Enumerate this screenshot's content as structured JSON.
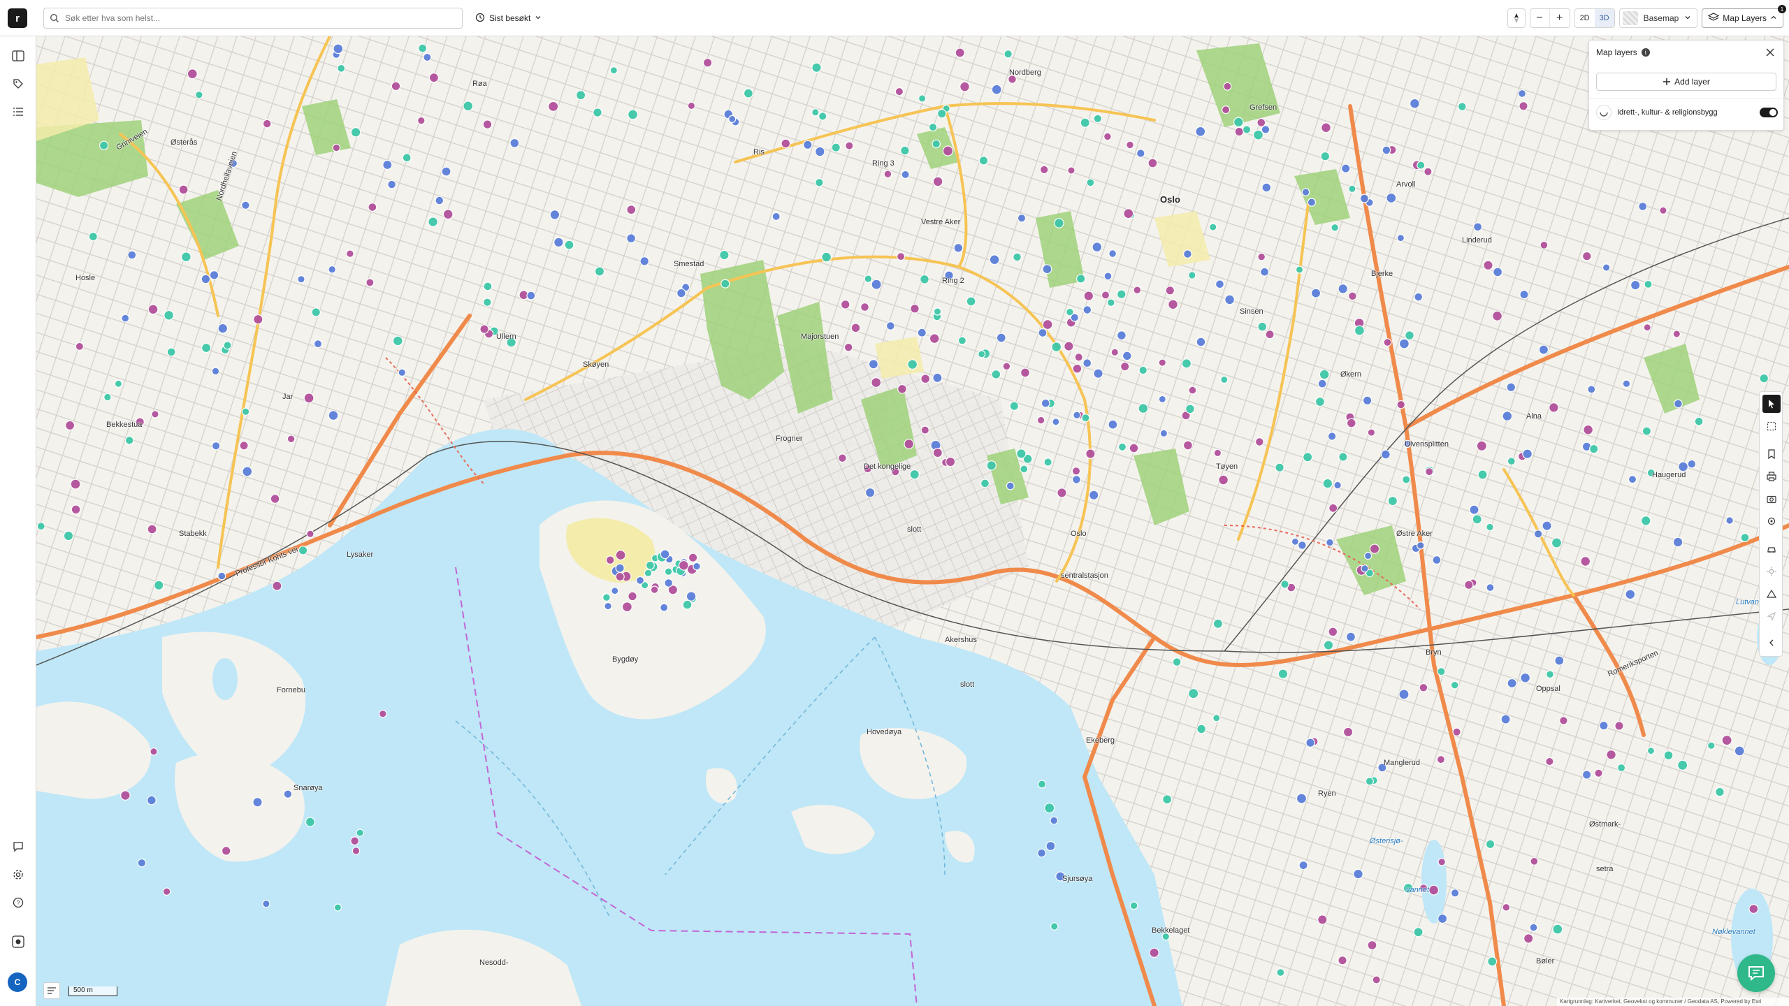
{
  "app": {
    "logo_letter": "r"
  },
  "search": {
    "placeholder": "Søk etter hva som helst..."
  },
  "recent": {
    "label": "Sist besøkt"
  },
  "view": {
    "mode_2d": "2D",
    "mode_3d": "3D",
    "active_mode": "3D"
  },
  "zoom": {
    "out": "−",
    "in": "+"
  },
  "basemap": {
    "label": "Basemap"
  },
  "map_layers_button": {
    "label": "Map Layers",
    "badge": "1"
  },
  "panel": {
    "title": "Map layers",
    "info": "i",
    "add_label": "Add layer",
    "layers": [
      {
        "name": "Idrett-, kultur- & religionsbygg",
        "visible": true
      }
    ]
  },
  "user": {
    "initial": "C"
  },
  "scale": {
    "label": "500 m"
  },
  "attribution": "Kartgrunnlag: Kartverket, Geovekst og kommuner / Geodata AS, Powered by Esri",
  "colors": {
    "water": "#bfe7f7",
    "park": "#9fd27a",
    "motorway": "#f08a4b",
    "primary_road": "#f6c454",
    "point_teal": "#3ec7a8",
    "point_blue": "#5b7fd9",
    "point_purple": "#b2509b",
    "chat": "#2fb88a"
  },
  "places": [
    {
      "name": "Oslo",
      "type": "big"
    },
    {
      "name": "Oslo",
      "type": "normal"
    },
    {
      "name": "Nordberg",
      "type": "normal"
    },
    {
      "name": "Grefsen",
      "type": "normal"
    },
    {
      "name": "Arvoll",
      "type": "normal"
    },
    {
      "name": "Linderud",
      "type": "normal"
    },
    {
      "name": "Bjerke",
      "type": "normal"
    },
    {
      "name": "Økern",
      "type": "normal"
    },
    {
      "name": "Alna",
      "type": "normal"
    },
    {
      "name": "Ulvensplitten",
      "type": "normal"
    },
    {
      "name": "Haugerud",
      "type": "normal"
    },
    {
      "name": "Østre Aker",
      "type": "normal"
    },
    {
      "name": "Røa",
      "type": "normal"
    },
    {
      "name": "Ris",
      "type": "normal"
    },
    {
      "name": "Østerås",
      "type": "normal"
    },
    {
      "name": "Vestre Aker",
      "type": "normal"
    },
    {
      "name": "Smestad",
      "type": "normal"
    },
    {
      "name": "Ring 3",
      "type": "normal"
    },
    {
      "name": "Ring 2",
      "type": "normal"
    },
    {
      "name": "Sinsen",
      "type": "normal"
    },
    {
      "name": "Hosle",
      "type": "normal"
    },
    {
      "name": "Ullern",
      "type": "normal"
    },
    {
      "name": "Skøyen",
      "type": "normal"
    },
    {
      "name": "Majorstuen",
      "type": "normal"
    },
    {
      "name": "Jar",
      "type": "normal"
    },
    {
      "name": "Bekkestua",
      "type": "normal"
    },
    {
      "name": "Frogner",
      "type": "normal"
    },
    {
      "name": "Det kongelige",
      "type": "normal"
    },
    {
      "name": "Tøyen",
      "type": "normal"
    },
    {
      "name": "Stabekk",
      "type": "normal"
    },
    {
      "name": "Lysaker",
      "type": "normal"
    },
    {
      "name": "Professor Kohts vei",
      "type": "normal"
    },
    {
      "name": "slott",
      "type": "normal"
    },
    {
      "name": "sentralstasjon",
      "type": "normal"
    },
    {
      "name": "Akershus",
      "type": "normal"
    },
    {
      "name": "slott",
      "type": "normal"
    },
    {
      "name": "Bygdøy",
      "type": "normal"
    },
    {
      "name": "Fornebu",
      "type": "normal"
    },
    {
      "name": "Hovedøya",
      "type": "normal"
    },
    {
      "name": "Ekeberg",
      "type": "normal"
    },
    {
      "name": "Snarøya",
      "type": "normal"
    },
    {
      "name": "Ryen",
      "type": "normal"
    },
    {
      "name": "Manglerud",
      "type": "normal"
    },
    {
      "name": "Bryn",
      "type": "normal"
    },
    {
      "name": "Oppsal",
      "type": "normal"
    },
    {
      "name": "Romeriksporten",
      "type": "normal"
    },
    {
      "name": "Østensjø-",
      "type": "water"
    },
    {
      "name": "vannet",
      "type": "water"
    },
    {
      "name": "Østmark-",
      "type": "normal"
    },
    {
      "name": "setra",
      "type": "normal"
    },
    {
      "name": "Nøklevannet",
      "type": "water"
    },
    {
      "name": "Lutvann",
      "type": "water"
    },
    {
      "name": "Sjursøya",
      "type": "normal"
    },
    {
      "name": "Bekkelaget",
      "type": "normal"
    },
    {
      "name": "Nesodd-",
      "type": "normal"
    },
    {
      "name": "Bøler",
      "type": "normal"
    },
    {
      "name": "Nordhellaveien",
      "type": "normal"
    },
    {
      "name": "Griniveien",
      "type": "normal"
    }
  ]
}
